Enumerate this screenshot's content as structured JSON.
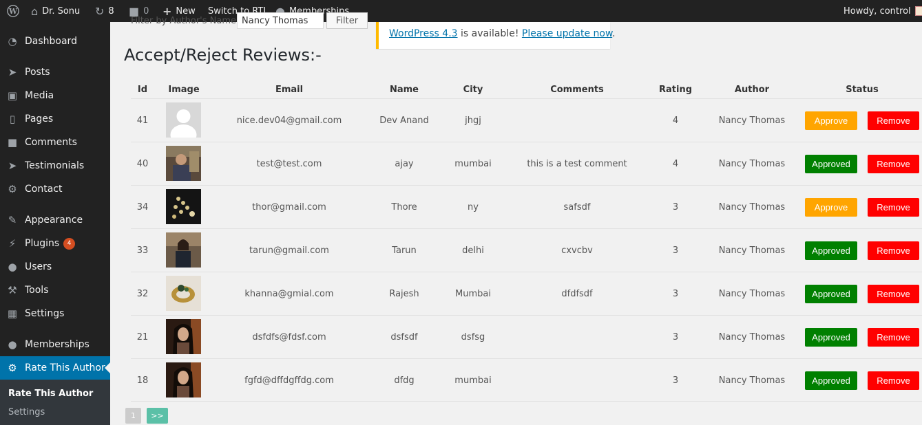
{
  "adminbar": {
    "wp_logo": "wordpress-logo-icon",
    "site_name": "Dr. Sonu",
    "updates_count": "8",
    "comments_count": "0",
    "new_label": "New",
    "rtl_label": "Switch to RTL",
    "memberships_label": "Memberships",
    "howdy": "Howdy, control"
  },
  "sidebar": {
    "items": [
      {
        "label": "Dashboard",
        "icon": "dashboard-icon"
      },
      {
        "label": "Posts",
        "icon": "pin-icon"
      },
      {
        "label": "Media",
        "icon": "media-icon"
      },
      {
        "label": "Pages",
        "icon": "pages-icon"
      },
      {
        "label": "Comments",
        "icon": "comment-icon"
      },
      {
        "label": "Testimonials",
        "icon": "pin-icon"
      },
      {
        "label": "Contact",
        "icon": "gear-icon"
      },
      {
        "label": "Appearance",
        "icon": "brush-icon"
      },
      {
        "label": "Plugins",
        "icon": "plugin-icon",
        "badge": "4"
      },
      {
        "label": "Users",
        "icon": "user-icon"
      },
      {
        "label": "Tools",
        "icon": "wrench-icon"
      },
      {
        "label": "Settings",
        "icon": "settings-icon"
      },
      {
        "label": "Memberships",
        "icon": "groups-icon"
      },
      {
        "label": "Rate This Author",
        "icon": "gear-icon"
      }
    ],
    "submenu": [
      {
        "label": "Rate This Author"
      },
      {
        "label": "Settings"
      }
    ]
  },
  "filter": {
    "label": "Filter by Author's Name",
    "value": "Nancy Thomas",
    "button": "Filter"
  },
  "notice": {
    "link1": "WordPress 4.3",
    "text": " is available! ",
    "link2": "Please update now",
    "end": "."
  },
  "page_title": "Accept/Reject Reviews:-",
  "table": {
    "headers": [
      "Id",
      "Image",
      "Email",
      "Name",
      "City",
      "Comments",
      "Rating",
      "Author",
      "Status"
    ],
    "rows": [
      {
        "id": "41",
        "image": "default-avatar",
        "email": "nice.dev04@gmail.com",
        "name": "Dev Anand",
        "city": "jhgj",
        "comments": "",
        "rating": "4",
        "author": "Nancy Thomas",
        "status": "Approve",
        "remove": "Remove"
      },
      {
        "id": "40",
        "image": "photo-man",
        "email": "test@test.com",
        "name": "ajay",
        "city": "mumbai",
        "comments": "this is a test comment",
        "rating": "4",
        "author": "Nancy Thomas",
        "status": "Approved",
        "remove": "Remove"
      },
      {
        "id": "34",
        "image": "photo-jewelry",
        "email": "thor@gmail.com",
        "name": "Thore",
        "city": "ny",
        "comments": "safsdf",
        "rating": "3",
        "author": "Nancy Thomas",
        "status": "Approve",
        "remove": "Remove"
      },
      {
        "id": "33",
        "image": "photo-woman",
        "email": "tarun@gmail.com",
        "name": "Tarun",
        "city": "delhi",
        "comments": "cxvcbv",
        "rating": "3",
        "author": "Nancy Thomas",
        "status": "Approved",
        "remove": "Remove"
      },
      {
        "id": "32",
        "image": "photo-ring",
        "email": "khanna@gmial.com",
        "name": "Rajesh",
        "city": "Mumbai",
        "comments": "dfdfsdf",
        "rating": "3",
        "author": "Nancy Thomas",
        "status": "Approved",
        "remove": "Remove"
      },
      {
        "id": "21",
        "image": "photo-girl",
        "email": "dsfdfs@fdsf.com",
        "name": "dsfsdf",
        "city": "dsfsg",
        "comments": "",
        "rating": "3",
        "author": "Nancy Thomas",
        "status": "Approved",
        "remove": "Remove"
      },
      {
        "id": "18",
        "image": "photo-girl",
        "email": "fgfd@dffdgffdg.com",
        "name": "dfdg",
        "city": "mumbai",
        "comments": "",
        "rating": "3",
        "author": "Nancy Thomas",
        "status": "Approved",
        "remove": "Remove"
      }
    ]
  },
  "pagination": {
    "page": "1",
    "next": ">>"
  },
  "colors": {
    "approve": "#ffa500",
    "approved": "#008000",
    "remove": "#ff0000",
    "accent": "#0073aa",
    "pagination_current": "#cccccc",
    "pagination_next": "#5bc0a7"
  }
}
